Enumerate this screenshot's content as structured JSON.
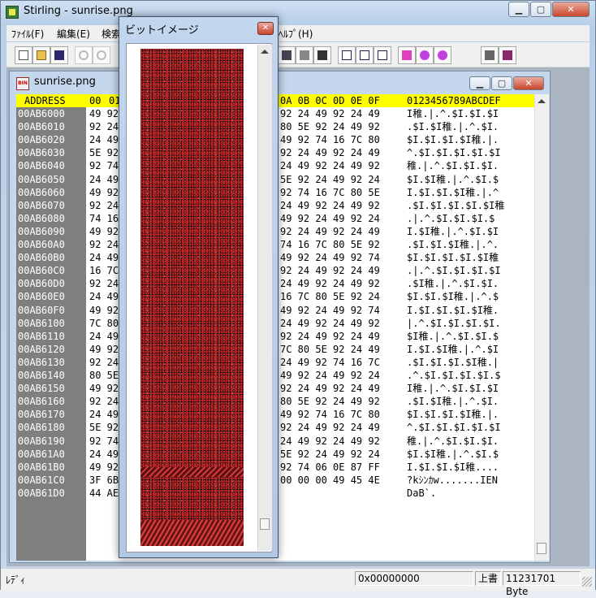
{
  "window": {
    "title": "Stirling - sunrise.png",
    "minimize": "▁",
    "maximize": "▢",
    "close": "✕"
  },
  "menu": [
    "ﾌｧｲﾙ(F)",
    "編集(E)",
    "検索",
    "ﾍﾙﾌﾟ(H)"
  ],
  "document": {
    "title": "sunrise.png",
    "icon_text": "BIN"
  },
  "hex_view": {
    "header": {
      "address": "ADDRESS",
      "col_start": "00",
      "col_start2": "01",
      "cols": "0A 0B 0C 0D 0E 0F",
      "ascii": "0123456789ABCDEF"
    },
    "rows": [
      {
        "addr": "00AB6000",
        "a": "49 92",
        "b": "92 24 49 92 24 49",
        "asc": "I稚.|.^.$I.$I.$I"
      },
      {
        "addr": "00AB6010",
        "a": "92 24",
        "b": "80 5E 92 24 49 92",
        "asc": ".$I.$I稚.|.^.$I."
      },
      {
        "addr": "00AB6020",
        "a": "24 49",
        "b": "49 92 74 16 7C 80",
        "asc": "$I.$I.$I.$I稚.|."
      },
      {
        "addr": "00AB6030",
        "a": "5E 92",
        "b": "92 24 49 92 24 49",
        "asc": "^.$I.$I.$I.$I.$I"
      },
      {
        "addr": "00AB6040",
        "a": "92 74",
        "b": "24 49 92 24 49 92",
        "asc": "稚.|.^.$I.$I.$I."
      },
      {
        "addr": "00AB6050",
        "a": "24 49",
        "b": "5E 92 24 49 92 24",
        "asc": "$I.$I稚.|.^.$I.$"
      },
      {
        "addr": "00AB6060",
        "a": "49 92",
        "b": "92 74 16 7C 80 5E",
        "asc": "I.$I.$I.$I稚.|.^"
      },
      {
        "addr": "00AB6070",
        "a": "92 24",
        "b": "24 49 92 24 49 92",
        "asc": ".$I.$I.$I.$I.$I稚"
      },
      {
        "addr": "00AB6080",
        "a": "74 16",
        "b": "49 92 24 49 92 24",
        "asc": ".|.^.$I.$I.$I.$"
      },
      {
        "addr": "00AB6090",
        "a": "49 92",
        "b": "92 24 49 92 24 49",
        "asc": "I.$I稚.|.^.$I.$I"
      },
      {
        "addr": "00AB60A0",
        "a": "92 24",
        "b": "74 16 7C 80 5E 92",
        "asc": ".$I.$I.$I稚.|.^."
      },
      {
        "addr": "00AB60B0",
        "a": "24 49",
        "b": "49 92 24 49 92 74",
        "asc": "$I.$I.$I.$I.$I稚"
      },
      {
        "addr": "00AB60C0",
        "a": "16 7C",
        "b": "92 24 49 92 24 49",
        "asc": ".|.^.$I.$I.$I.$I"
      },
      {
        "addr": "00AB60D0",
        "a": "92 24",
        "b": "24 49 92 24 49 92",
        "asc": ".$I稚.|.^.$I.$I."
      },
      {
        "addr": "00AB60E0",
        "a": "24 49",
        "b": "16 7C 80 5E 92 24",
        "asc": "$I.$I.$I稚.|.^.$"
      },
      {
        "addr": "00AB60F0",
        "a": "49 92",
        "b": "49 92 24 49 92 74",
        "asc": "I.$I.$I.$I.$I稚."
      },
      {
        "addr": "00AB6100",
        "a": "7C 80",
        "b": "24 49 92 24 49 92",
        "asc": "|.^.$I.$I.$I.$I."
      },
      {
        "addr": "00AB6110",
        "a": "24 49",
        "b": "92 24 49 92 24 49",
        "asc": "$I稚.|.^.$I.$I.$"
      },
      {
        "addr": "00AB6120",
        "a": "49 92",
        "b": "7C 80 5E 92 24 49",
        "asc": "I.$I.$I稚.|.^.$I"
      },
      {
        "addr": "00AB6130",
        "a": "92 24",
        "b": "24 49 92 74 16 7C",
        "asc": ".$I.$I.$I.$I稚.|"
      },
      {
        "addr": "00AB6140",
        "a": "80 5E",
        "b": "49 92 24 49 92 24",
        "asc": ".^.$I.$I.$I.$I.$"
      },
      {
        "addr": "00AB6150",
        "a": "49 92",
        "b": "92 24 49 92 24 49",
        "asc": "I稚.|.^.$I.$I.$I"
      },
      {
        "addr": "00AB6160",
        "a": "92 24",
        "b": "80 5E 92 24 49 92",
        "asc": ".$I.$I稚.|.^.$I."
      },
      {
        "addr": "00AB6170",
        "a": "24 49",
        "b": "49 92 74 16 7C 80",
        "asc": "$I.$I.$I.$I稚.|."
      },
      {
        "addr": "00AB6180",
        "a": "5E 92",
        "b": "92 24 49 92 24 49",
        "asc": "^.$I.$I.$I.$I.$I"
      },
      {
        "addr": "00AB6190",
        "a": "92 74",
        "b": "24 49 92 24 49 92",
        "asc": "稚.|.^.$I.$I.$I."
      },
      {
        "addr": "00AB61A0",
        "a": "24 49",
        "b": "5E 92 24 49 92 24",
        "asc": "$I.$I稚.|.^.$I.$"
      },
      {
        "addr": "00AB61B0",
        "a": "49 92",
        "b": "92 74 06 0E 87 FF",
        "asc": "I.$I.$I.$I稚...."
      },
      {
        "addr": "00AB61C0",
        "a": "3F 6B",
        "b": "00 00 00 49 45 4E",
        "asc": "?kｼﾝｶw.......IEN"
      },
      {
        "addr": "00AB61D0",
        "a": "44 AE",
        "b": "",
        "asc": "DaB`."
      }
    ]
  },
  "bitmap_window": {
    "title": "ビットイメージ",
    "close": "✕"
  },
  "status": {
    "ready": "ﾚﾃﾞｨ",
    "offset": "0x00000000",
    "mode": "上書",
    "size": "11231701 Byte"
  },
  "colors": {
    "header_bg": "#ffff00",
    "address_bg": "#7f7f7f"
  }
}
